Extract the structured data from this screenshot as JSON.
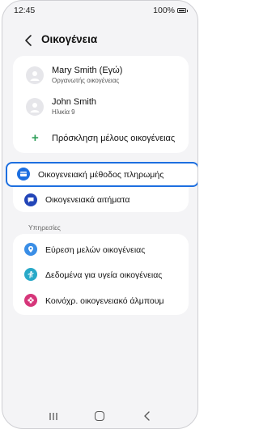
{
  "status_bar": {
    "time": "12:45",
    "battery": "100%"
  },
  "header": {
    "title": "Οικογένεια"
  },
  "members": [
    {
      "name": "Mary Smith (Εγώ)",
      "role": "Οργανωτής οικογένειας"
    },
    {
      "name": "John Smith",
      "role": "Ηλικία 9"
    }
  ],
  "invite": {
    "label": "Πρόσκληση μέλους οικογένειας"
  },
  "family_payment": {
    "label": "Οικογενειακή μέθοδος πληρωμής"
  },
  "family_requests": {
    "label": "Οικογενειακά αιτήματα"
  },
  "services": {
    "section_label": "Υπηρεσίες",
    "items": [
      {
        "label": "Εύρεση μελών οικογένειας"
      },
      {
        "label": "Δεδομένα για υγεία οικογένειας"
      },
      {
        "label": "Κοινόχρ. οικογενειακό άλμπουμ"
      }
    ]
  },
  "colors": {
    "accent_blue": "#1d6fe0",
    "invite_green": "#2e9e58",
    "find_blue": "#3a8ee6",
    "health_teal": "#28a9c8",
    "album_pink": "#d6367a",
    "requests_navy": "#2346b8"
  }
}
